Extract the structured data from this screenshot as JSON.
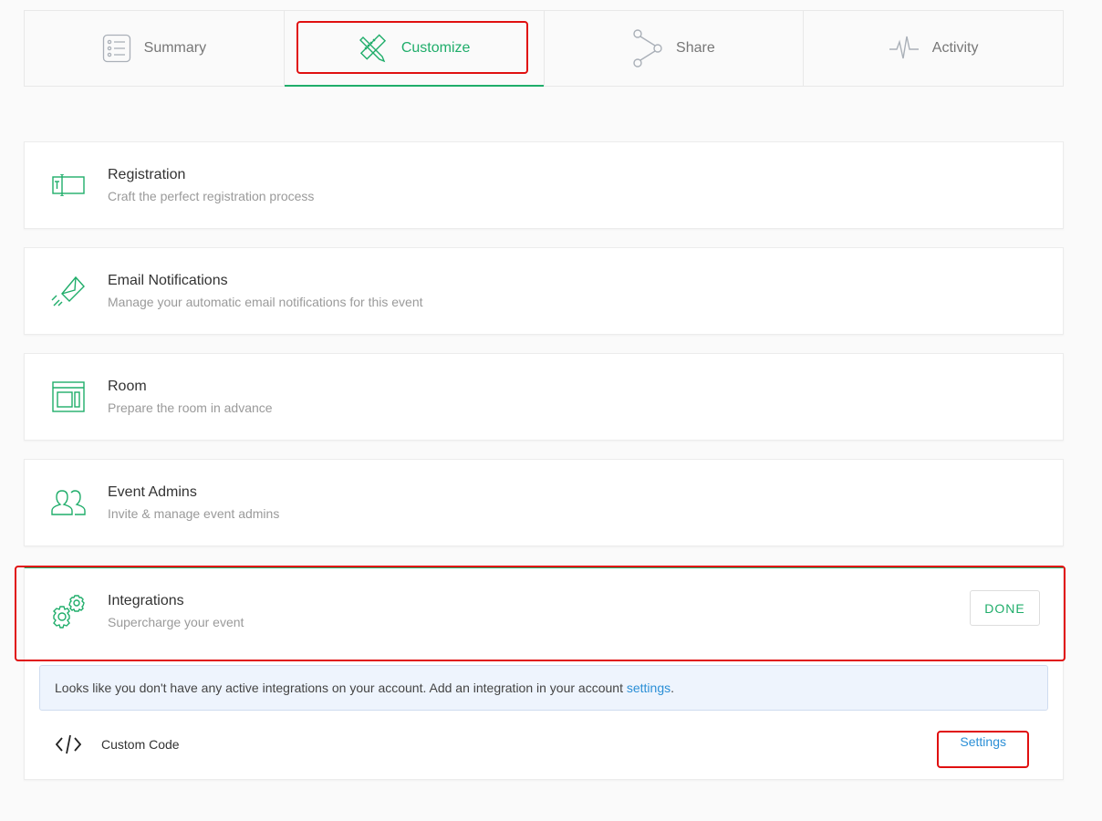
{
  "tabs": [
    {
      "label": "Summary",
      "icon": "list-icon",
      "active": false
    },
    {
      "label": "Customize",
      "icon": "pencil-ruler-icon",
      "active": true
    },
    {
      "label": "Share",
      "icon": "share-icon",
      "active": false
    },
    {
      "label": "Activity",
      "icon": "pulse-icon",
      "active": false
    }
  ],
  "sections": [
    {
      "title": "Registration",
      "subtitle": "Craft the perfect registration process",
      "icon": "registration-form-icon"
    },
    {
      "title": "Email Notifications",
      "subtitle": "Manage your automatic email notifications for this event",
      "icon": "paper-plane-icon"
    },
    {
      "title": "Room",
      "subtitle": "Prepare the room in advance",
      "icon": "room-layout-icon"
    },
    {
      "title": "Event Admins",
      "subtitle": "Invite & manage event admins",
      "icon": "users-icon"
    }
  ],
  "integrations": {
    "title": "Integrations",
    "subtitle": "Supercharge your event",
    "icon": "gears-icon",
    "done_label": "DONE",
    "notice_text": "Looks like you don't have any active integrations on your account. Add an integration in your account ",
    "notice_link": "settings",
    "notice_end": ".",
    "custom_code": {
      "label": "Custom Code",
      "icon": "code-icon",
      "settings_label": "Settings"
    }
  },
  "colors": {
    "accent": "#1fad6a",
    "link": "#2b8fd6",
    "highlight": "#e01010"
  }
}
